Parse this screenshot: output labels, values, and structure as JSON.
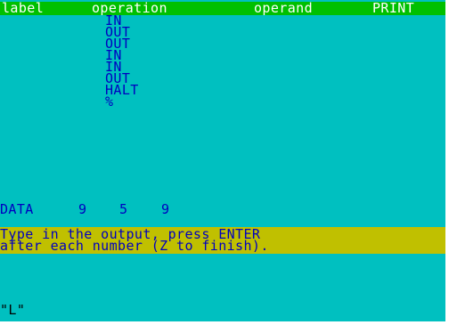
{
  "header": {
    "label_col": "label",
    "operation_col": "operation",
    "operand_col": "operand",
    "print_col": "PRINT"
  },
  "program": {
    "operations": [
      "IN",
      "OUT",
      "OUT",
      "IN",
      "IN",
      "OUT",
      "HALT",
      "%"
    ]
  },
  "data": {
    "label": "DATA",
    "values": [
      "9",
      "5",
      "9"
    ]
  },
  "prompt": {
    "line1": "Type in the output, press ENTER",
    "line2": "after each number (Z to finish)."
  },
  "status": {
    "cursor": "\"L\""
  },
  "colors": {
    "background": "#00c0c0",
    "header_bg": "#00c000",
    "header_text": "#ffffff",
    "ink": "#0000c0",
    "prompt_bg": "#c0c000"
  }
}
